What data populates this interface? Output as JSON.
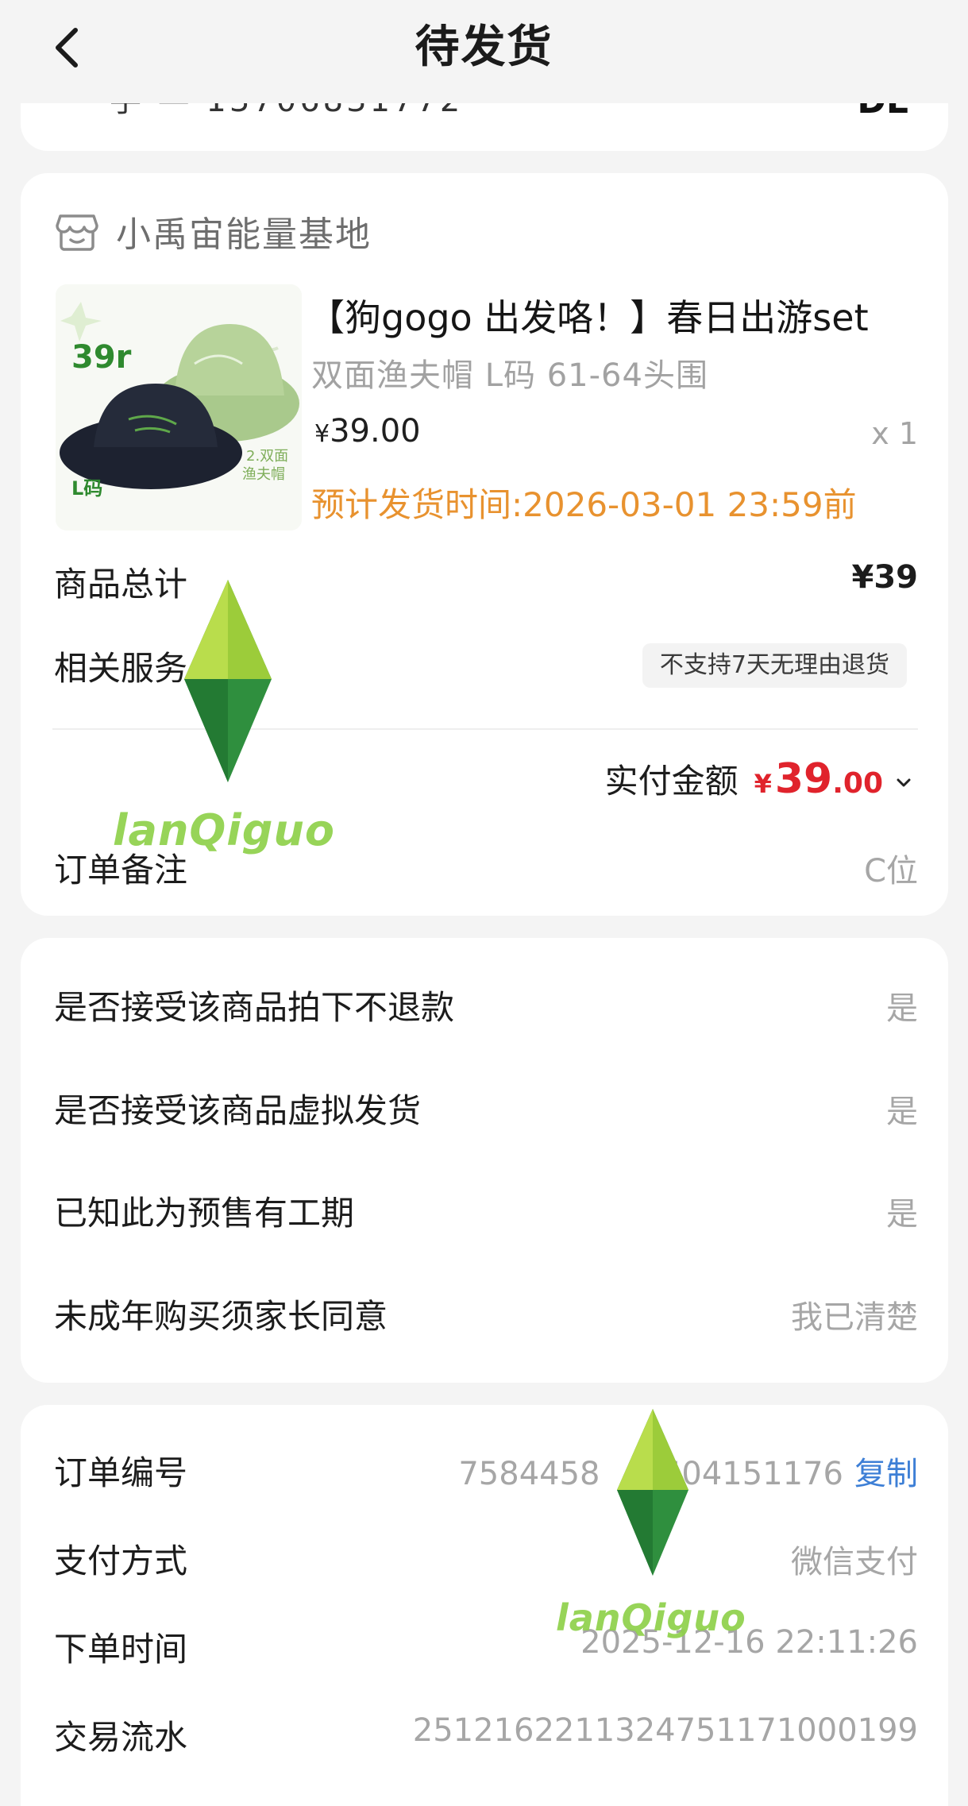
{
  "header": {
    "title": "待发货"
  },
  "shop": {
    "name": "小禹宙能量基地"
  },
  "product": {
    "title": "【狗gogo 出发咯！】春日出游set",
    "spec": "双面渔夫帽 L码 61-64头围",
    "price_symbol": "¥",
    "price_value": "39.00",
    "quantity": "x 1",
    "ship_time": "预计发货时间:2026-03-01 23:59前",
    "image_text": {
      "price_tag": "39r",
      "size": "L码",
      "caption_line1": "2.双面",
      "caption_line2": "渔夫帽"
    }
  },
  "summary": {
    "goods_total_label": "商品总计",
    "goods_total_value": "¥39",
    "service_label": "相关服务",
    "service_chip": "不支持7天无理由退货",
    "paid_label": "实付金额",
    "paid_symbol": "¥",
    "paid_int": "39",
    "paid_dec": ".00",
    "note_label": "订单备注",
    "note_value": "C位"
  },
  "agreements": [
    {
      "label": "是否接受该商品拍下不退款",
      "value": "是"
    },
    {
      "label": "是否接受该商品虚拟发货",
      "value": "是"
    },
    {
      "label": "已知此为预售有工期",
      "value": "是"
    },
    {
      "label": "未成年购买须家长同意",
      "value": "我已清楚"
    }
  ],
  "order_info": {
    "order_no_label": "订单编号",
    "order_no_value": "7584458",
    "order_no_value_tail": "6504151176",
    "copy_label": "复制",
    "pay_method_label": "支付方式",
    "pay_method_value": "微信支付",
    "order_time_label": "下单时间",
    "order_time_value": "2025-12-16 22:11:26",
    "trade_no_label": "交易流水",
    "trade_no_value": "2512162211324751171000199"
  },
  "watermark": {
    "text": "lanQiguo"
  },
  "colors": {
    "orange": "#e8922f",
    "red": "#e0232c",
    "blue": "#3d7fd6",
    "watermark_green": "#8fd14a"
  }
}
